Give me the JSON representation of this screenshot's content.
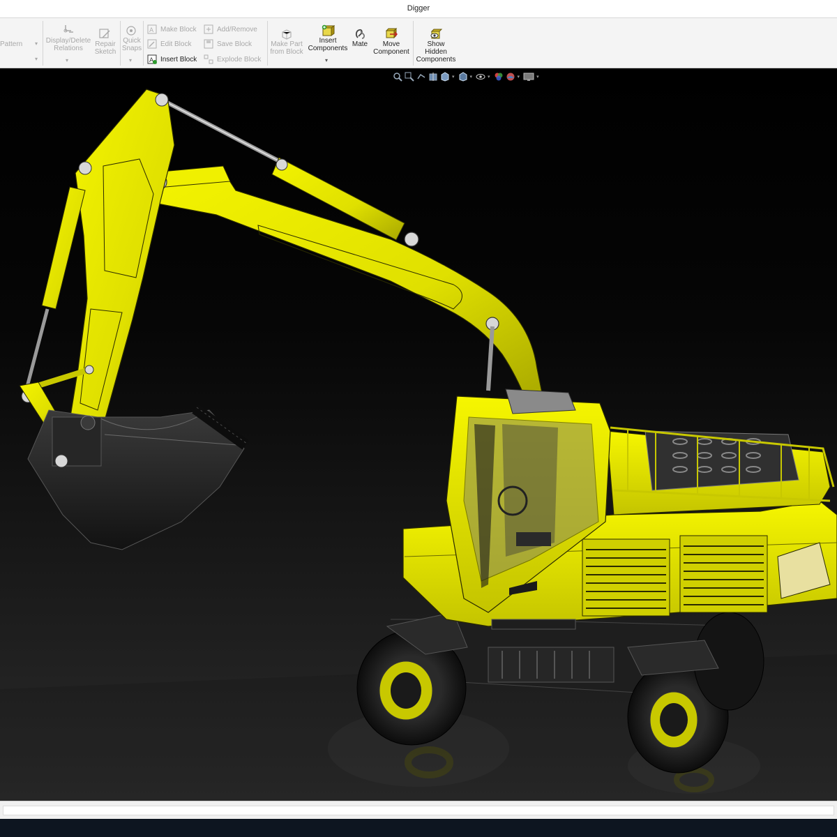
{
  "window": {
    "title": "Digger"
  },
  "ribbon": {
    "pattern_label": "Pattern",
    "display_delete_relations": "Display/Delete\nRelations",
    "repair_sketch": "Repair\nSketch",
    "quick_snaps": "Quick\nSnaps",
    "make_block": "Make Block",
    "edit_block": "Edit Block",
    "insert_block": "Insert Block",
    "add_remove": "Add/Remove",
    "save_block": "Save Block",
    "explode_block": "Explode Block",
    "make_part_from_block": "Make Part\nfrom Block",
    "insert_components": "Insert\nComponents",
    "mate": "Mate",
    "move_component": "Move\nComponent",
    "show_hidden_components": "Show\nHidden\nComponents"
  },
  "heads_up_toolbar": {
    "items": [
      "zoom-to-fit-icon",
      "zoom-to-area-icon",
      "previous-view-icon",
      "section-view-icon",
      "view-orientation-icon",
      "display-style-icon",
      "hide-show-items-icon",
      "edit-appearance-icon",
      "apply-scene-icon",
      "view-settings-icon"
    ]
  },
  "model": {
    "name": "Digger",
    "body_color": "#e6e600",
    "dark_color": "#1a1a1a",
    "accent": "#c8c800"
  }
}
